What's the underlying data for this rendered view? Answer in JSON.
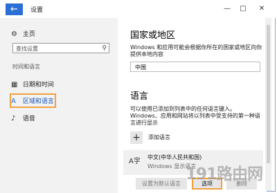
{
  "window": {
    "title": "设置",
    "back_glyph": "←",
    "min_glyph": "—",
    "max_glyph": "□",
    "close_glyph": "✕"
  },
  "sidebar": {
    "home": {
      "icon": "gear-icon",
      "glyph": "⚙",
      "label": "主页"
    },
    "search": {
      "placeholder": "查找设置",
      "icon": "search-icon",
      "glyph": "⚲"
    },
    "group_label": "时间和语言",
    "items": [
      {
        "icon": "calendar-clock-icon",
        "glyph": "▦",
        "label": "日期和时间"
      },
      {
        "icon": "region-language-icon",
        "glyph": "A",
        "label": "区域和语言"
      },
      {
        "icon": "microphone-icon",
        "glyph": "♪",
        "label": "语音"
      }
    ]
  },
  "region": {
    "heading": "国家或地区",
    "description": "Windows 和应用可能会根据你所在的国家或地区向你提供本地内容",
    "selected": "中国"
  },
  "language": {
    "heading": "语言",
    "description": "可以使用已添加到列表中的任何语言键入。Windows、应用和网站将以列表中受支持的第一种语言进行显示",
    "add_label": "添加语言",
    "add_glyph": "+",
    "entry": {
      "icon": "language-icon",
      "glyph": "A字",
      "name": "中文(中华人民共和国)",
      "sub": "Windows 显示语言"
    },
    "buttons": {
      "default": "设置为默认语言",
      "options": "选项",
      "remove": "删除"
    }
  },
  "watermark": "191路由网"
}
